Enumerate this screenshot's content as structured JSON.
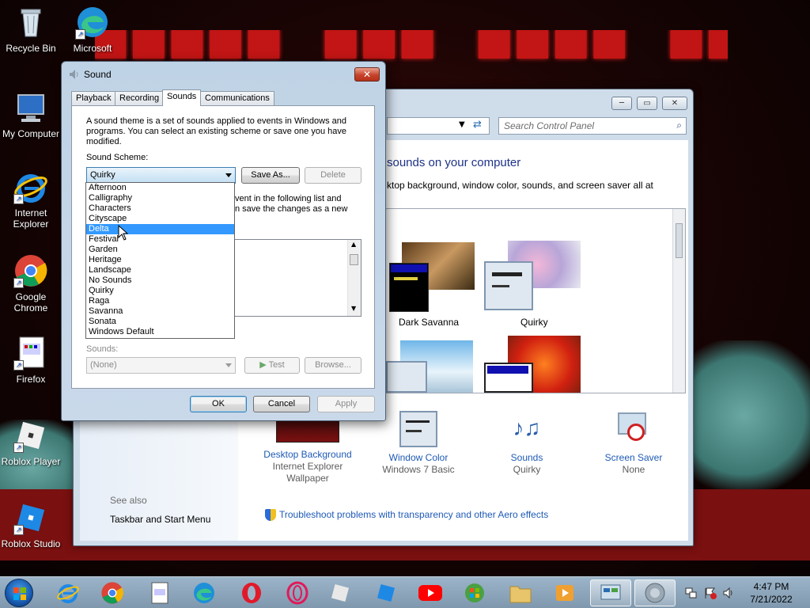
{
  "desktop": {
    "icons": [
      {
        "label": "Recycle Bin"
      },
      {
        "label": "Microsoft"
      },
      {
        "label": "My Computer"
      },
      {
        "label": "Internet Explorer"
      },
      {
        "label": "Google Chrome"
      },
      {
        "label": "Firefox"
      },
      {
        "label": "Roblox Player"
      },
      {
        "label": "Roblox Studio"
      }
    ]
  },
  "taskbar": {
    "time": "4:47 PM",
    "date": "7/21/2022"
  },
  "personalization": {
    "search_placeholder": "Search Control Panel",
    "heading": "sounds on your computer",
    "subheading": "ktop background, window color, sounds, and screen saver all at",
    "themes": [
      {
        "label": "Dark Savanna"
      },
      {
        "label": "Quirky"
      }
    ],
    "bottom": [
      {
        "link": "Desktop Background",
        "sub": "Internet Explorer Wallpaper"
      },
      {
        "link": "Window Color",
        "sub": "Windows 7 Basic"
      },
      {
        "link": "Sounds",
        "sub": "Quirky"
      },
      {
        "link": "Screen Saver",
        "sub": "None"
      }
    ],
    "see_also": "See also",
    "see_also_link": "Taskbar and Start Menu",
    "troubleshoot": "Troubleshoot problems with transparency and other Aero effects"
  },
  "sound_dialog": {
    "title": "Sound",
    "tabs": [
      "Playback",
      "Recording",
      "Sounds",
      "Communications"
    ],
    "active_tab": "Sounds",
    "description": "A sound theme is a set of sounds applied to events in Windows and programs.  You can select an existing scheme or save one you have modified.",
    "scheme_label": "Sound Scheme:",
    "scheme_value": "Quirky",
    "save_as": "Save As...",
    "delete": "Delete",
    "partial_text_1": "vent in the following list and",
    "partial_text_2": "n save the changes as a new",
    "sounds_label": "Sounds:",
    "sounds_value": "(None)",
    "test": "Test",
    "browse": "Browse...",
    "ok": "OK",
    "cancel": "Cancel",
    "apply": "Apply",
    "dropdown_options": [
      "Afternoon",
      "Calligraphy",
      "Characters",
      "Cityscape",
      "Delta",
      "Festival",
      "Garden",
      "Heritage",
      "Landscape",
      "No Sounds",
      "Quirky",
      "Raga",
      "Savanna",
      "Sonata",
      "Windows Default"
    ],
    "highlighted_option": "Delta"
  },
  "colors": {
    "accent": "#3399ff",
    "link": "#1e5ab6",
    "close": "#c7432a"
  }
}
